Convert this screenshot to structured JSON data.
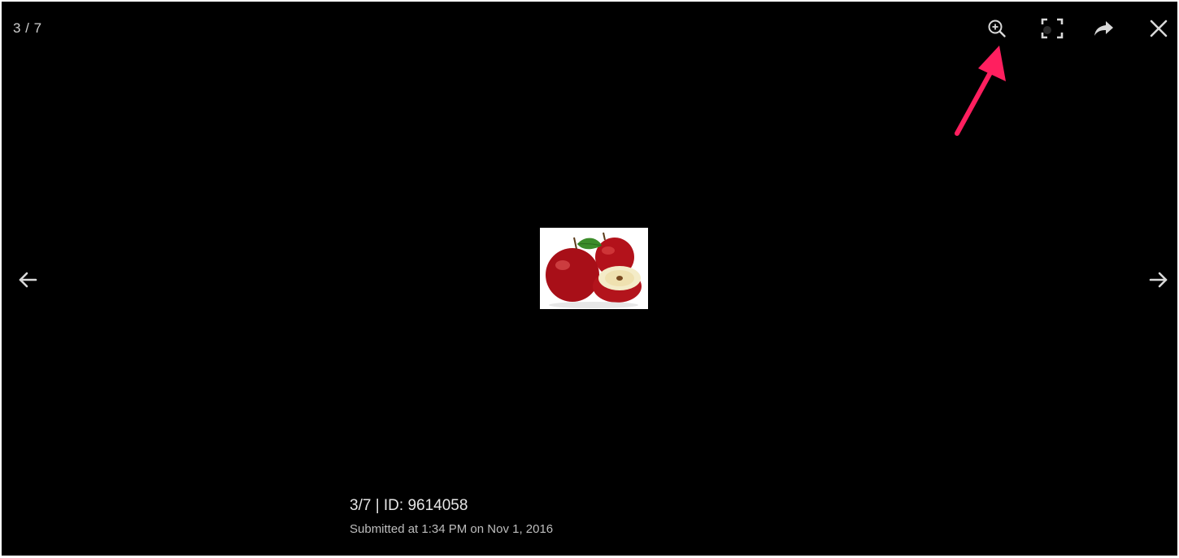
{
  "viewer": {
    "counter": "3 / 7",
    "caption_title": "3/7 | ID: 9614058",
    "caption_subtitle": "Submitted at 1:34 PM on Nov 1, 2016"
  },
  "toolbar": {
    "zoom_icon": "zoom-in-icon",
    "fullscreen_icon": "fullscreen-icon",
    "share_icon": "share-icon",
    "close_icon": "close-icon"
  },
  "navigation": {
    "prev_icon": "arrow-left-icon",
    "next_icon": "arrow-right-icon"
  },
  "image": {
    "alt": "apples"
  },
  "colors": {
    "background": "#000000",
    "icon": "#d8d8d8",
    "annotation_arrow": "#ff1f5f"
  }
}
